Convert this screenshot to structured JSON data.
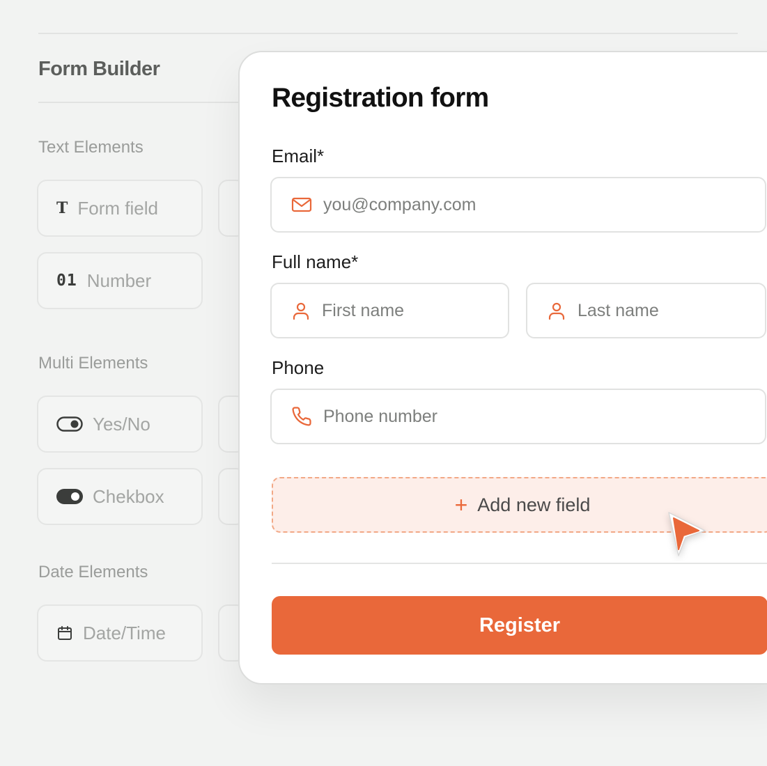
{
  "sidebar": {
    "title": "Form Builder",
    "sections": [
      {
        "label": "Text Elements",
        "items": [
          {
            "label": "Form field",
            "icon": "text-type-icon"
          },
          {
            "label": "Number",
            "icon": "number-icon",
            "glyph": "01"
          }
        ]
      },
      {
        "label": "Multi Elements",
        "items": [
          {
            "label": "Yes/No",
            "icon": "toggle-off-icon"
          },
          {
            "label": "Chekbox",
            "icon": "toggle-on-icon"
          }
        ]
      },
      {
        "label": "Date Elements",
        "items": [
          {
            "label": "Date/Time",
            "icon": "calendar-icon"
          }
        ]
      }
    ]
  },
  "form": {
    "title": "Registration form",
    "email": {
      "label": "Email*",
      "placeholder": "you@company.com",
      "icon": "mail-icon"
    },
    "full_name": {
      "label": "Full name*",
      "first_placeholder": "First name",
      "last_placeholder": "Last name",
      "icon": "user-icon"
    },
    "phone": {
      "label": "Phone",
      "placeholder": "Phone number",
      "icon": "phone-icon"
    },
    "add_field": {
      "label": "Add new field",
      "icon": "plus-icon"
    },
    "submit": {
      "label": "Register"
    }
  },
  "colors": {
    "accent": "#E9683A",
    "accent_soft": "#FDEEE9",
    "background": "#F2F3F2"
  }
}
